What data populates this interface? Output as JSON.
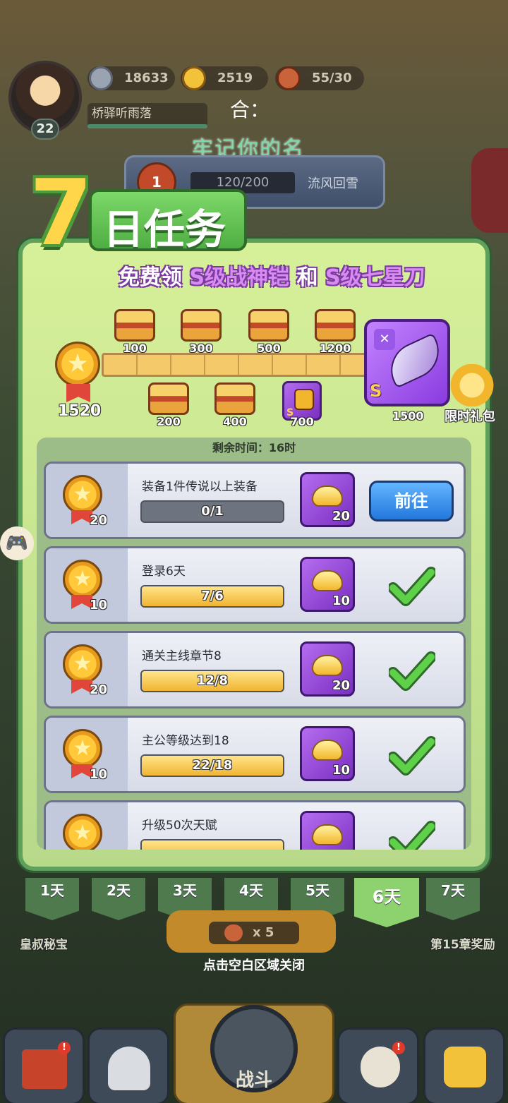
{
  "hud": {
    "player_name": "桥驿听雨落",
    "level": "22",
    "silver": "18633",
    "gold": "2519",
    "stamina": "55/30",
    "overlay_line1": "合：",
    "overlay_line2": "牢记你的名",
    "rank_progress": "120/200",
    "rank_name": "流风回雪",
    "rank_number": "1"
  },
  "panel": {
    "title_number": "7",
    "title_text": "日任务",
    "subtitle_prefix": "免费领",
    "subtitle_item1": "S级战神铠",
    "subtitle_and": "和",
    "subtitle_item2": "S级七星刀",
    "total_score": "1520",
    "top_chests": [
      "100",
      "300",
      "500",
      "1200"
    ],
    "bottom_chests": [
      "200",
      "400",
      "700"
    ],
    "final_reward_value": "1500",
    "final_reward_grade": "S",
    "skin_grade": "S",
    "gift_label": "限时礼包",
    "timer": "剩余时间：16时"
  },
  "tasks": [
    {
      "title": "装备1件传说以上装备",
      "points": "20",
      "progress": "0/1",
      "fill": 0,
      "reward": "20",
      "status": "goto",
      "button": "前往"
    },
    {
      "title": "登录6天",
      "points": "10",
      "progress": "7/6",
      "fill": 1,
      "reward": "10",
      "status": "done"
    },
    {
      "title": "通关主线章节8",
      "points": "20",
      "progress": "12/8",
      "fill": 1,
      "reward": "20",
      "status": "done"
    },
    {
      "title": "主公等级达到18",
      "points": "10",
      "progress": "22/18",
      "fill": 1,
      "reward": "10",
      "status": "done"
    },
    {
      "title": "升级50次天赋",
      "points": "",
      "progress": "",
      "fill": 1,
      "reward": "",
      "status": "done"
    }
  ],
  "days": [
    "1天",
    "2天",
    "3天",
    "4天",
    "5天",
    "6天",
    "7天"
  ],
  "active_day_index": 5,
  "bottom": {
    "close_hint": "点击空白区域关闭",
    "left_label": "皇叔秘宝",
    "right_label": "第15章奖励",
    "meat_count": "x 5",
    "battle_label": "战斗",
    "alert_mark": "!"
  },
  "colors": {
    "panel_green": "#c4e38e",
    "button_blue": "#2277dc",
    "reward_purple": "#7a2fc0",
    "check_green": "#5fd04a"
  }
}
